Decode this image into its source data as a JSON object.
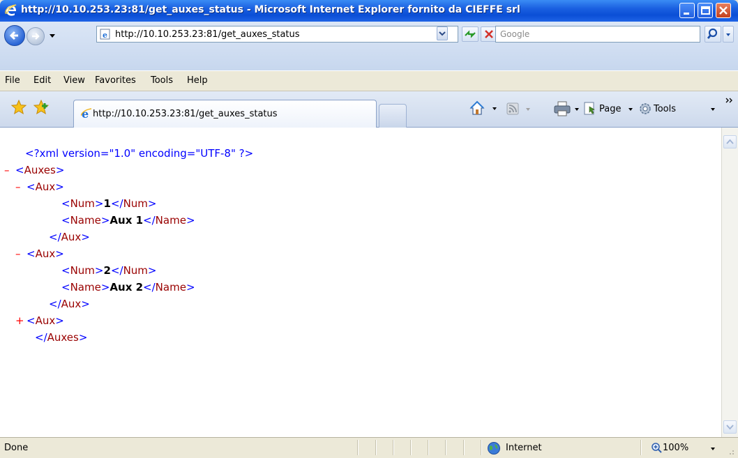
{
  "window": {
    "title": "http://10.10.253.23:81/get_auxes_status - Microsoft Internet Explorer fornito da CIEFFE srl"
  },
  "address": {
    "url": "http://10.10.253.23:81/get_auxes_status",
    "search_placeholder": "Google"
  },
  "menu": [
    "File",
    "Edit",
    "View",
    "Favorites",
    "Tools",
    "Help"
  ],
  "tab": {
    "label": "http://10.10.253.23:81/get_auxes_status"
  },
  "commands": {
    "page_label": "Page",
    "tools_label": "Tools"
  },
  "xml": {
    "declaration": "<?xml version=\"1.0\" encoding=\"UTF-8\" ?>",
    "root": "Auxes",
    "aux": "Aux",
    "num": "Num",
    "name": "Name",
    "items": [
      {
        "num": "1",
        "name": "Aux 1"
      },
      {
        "num": "2",
        "name": "Aux 2"
      }
    ],
    "collapse_glyph": "–",
    "expand_glyph": "+"
  },
  "status": {
    "text": "Done",
    "zone": "Internet",
    "zoom": "100%"
  },
  "colors": {
    "pi": "#0000ff",
    "tag": "#990000",
    "toggle": "#ff0000"
  }
}
